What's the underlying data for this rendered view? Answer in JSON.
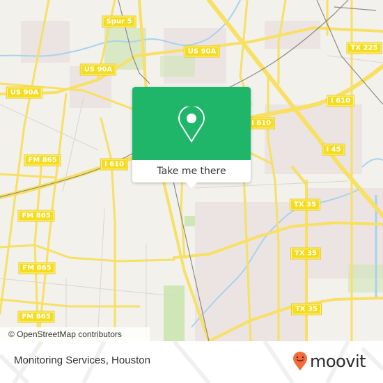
{
  "map": {
    "road_labels": [
      {
        "text": "Spur 5",
        "kind": "shield"
      },
      {
        "text": "US 90A",
        "kind": "shield"
      },
      {
        "text": "US 90A",
        "kind": "shield"
      },
      {
        "text": "US 90A",
        "kind": "shield"
      },
      {
        "text": "TX 225",
        "kind": "shield"
      },
      {
        "text": "I 610",
        "kind": "shield"
      },
      {
        "text": "I 610",
        "kind": "shield"
      },
      {
        "text": "I 610",
        "kind": "shield"
      },
      {
        "text": "I 45",
        "kind": "shield"
      },
      {
        "text": "FM 865",
        "kind": "shield"
      },
      {
        "text": "FM 865",
        "kind": "shield"
      },
      {
        "text": "FM 865",
        "kind": "shield"
      },
      {
        "text": "FM 865",
        "kind": "shield"
      },
      {
        "text": "TX 35",
        "kind": "shield"
      },
      {
        "text": "TX 35",
        "kind": "shield"
      },
      {
        "text": "TX 35",
        "kind": "shield"
      }
    ],
    "attribution": "© OpenStreetMap contributors",
    "colors": {
      "land": "#f2f1ec",
      "road": "#f7e063",
      "water": "#a9d3ec",
      "park": "#cfe6b5",
      "urban": "#ebe4e2"
    }
  },
  "popup": {
    "icon": "location-pin-icon",
    "button_label": "Take me there",
    "color": "#1fb66a"
  },
  "footer": {
    "place_name": "Monitoring Services, Houston",
    "brand": "moovit",
    "brand_color": "#f26b3a"
  }
}
